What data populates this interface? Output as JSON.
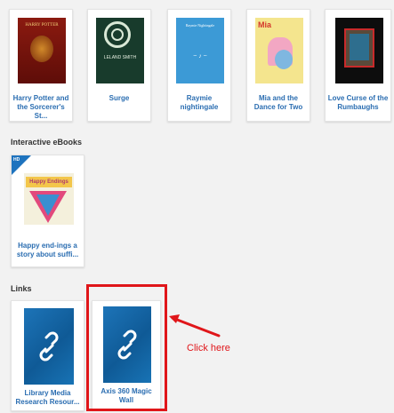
{
  "books": [
    {
      "label": "Harry Potter and the Sorcerer's St...",
      "cover_text": "HARRY POTTER"
    },
    {
      "label": "Surge",
      "cover_text": "LELAND SMITH"
    },
    {
      "label": "Raymie nightingale",
      "cover_text": "Raymie Nightingale"
    },
    {
      "label": "Mia and the Dance for Two",
      "cover_text": "Mia"
    },
    {
      "label": "Love Curse of the Rumbaughs",
      "cover_text": ""
    }
  ],
  "interactive": {
    "title": "Interactive eBooks",
    "items": [
      {
        "label": "Happy end-ings a story about suffi...",
        "badge": "HD",
        "cover_text": "Happy Endings"
      }
    ]
  },
  "links": {
    "title": "Links",
    "items": [
      {
        "label": "Library Media Research Resour..."
      },
      {
        "label": "Axis 360 Magic Wall"
      }
    ]
  },
  "annotation": {
    "text": "Click here",
    "color": "#e0161a"
  },
  "colors": {
    "link_text": "#2a6db1",
    "background": "#f2f2f2"
  }
}
